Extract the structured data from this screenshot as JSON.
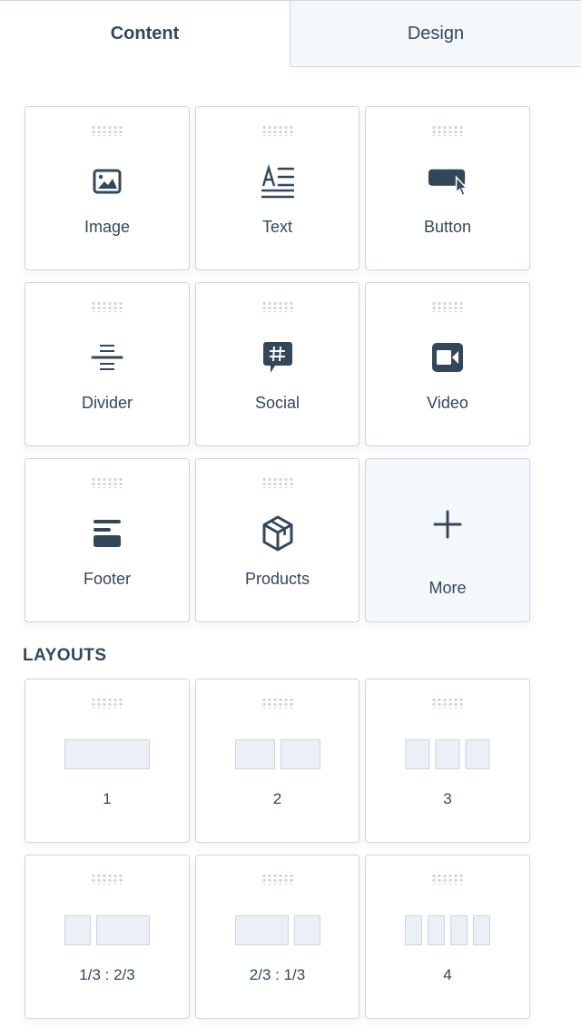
{
  "tabs": [
    {
      "label": "Content",
      "active": true
    },
    {
      "label": "Design",
      "active": false
    }
  ],
  "modules": [
    {
      "label": "Image",
      "icon": "image-icon"
    },
    {
      "label": "Text",
      "icon": "text-icon"
    },
    {
      "label": "Button",
      "icon": "button-cursor-icon"
    },
    {
      "label": "Divider",
      "icon": "divider-icon"
    },
    {
      "label": "Social",
      "icon": "social-hashtag-icon"
    },
    {
      "label": "Video",
      "icon": "video-camera-icon"
    },
    {
      "label": "Footer",
      "icon": "footer-icon"
    },
    {
      "label": "Products",
      "icon": "product-box-icon"
    },
    {
      "label": "More",
      "icon": "plus-icon"
    }
  ],
  "layouts_title": "LAYOUTS",
  "layouts": [
    {
      "label": "1",
      "columns": [
        1
      ]
    },
    {
      "label": "2",
      "columns": [
        1,
        1
      ]
    },
    {
      "label": "3",
      "columns": [
        1,
        1,
        1
      ]
    },
    {
      "label": "1/3 : 2/3",
      "columns": [
        1,
        2
      ]
    },
    {
      "label": "2/3 : 1/3",
      "columns": [
        2,
        1
      ]
    },
    {
      "label": "4",
      "columns": [
        1,
        1,
        1,
        1
      ]
    }
  ],
  "colors": {
    "text": "#33475b",
    "border": "#cbd6e2",
    "inactive_bg": "#f5f8fa",
    "preview_fill": "#eaf0f6"
  }
}
